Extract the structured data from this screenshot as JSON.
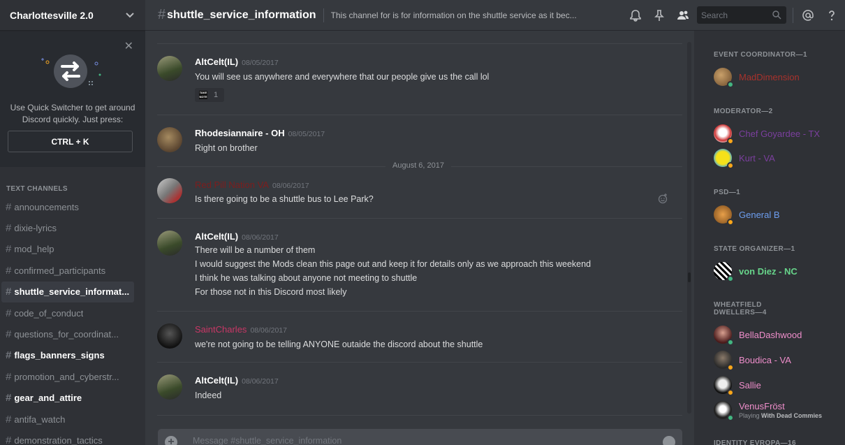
{
  "guild": {
    "name": "Charlottesville 2.0"
  },
  "quick_switcher": {
    "text_line1": "Use Quick Switcher to get around",
    "text_line2": "Discord quickly. Just press:",
    "shortcut": "CTRL + K"
  },
  "sidebar": {
    "category": "TEXT CHANNELS",
    "channels": [
      {
        "name": "announcements",
        "state": "normal"
      },
      {
        "name": "dixie-lyrics",
        "state": "normal"
      },
      {
        "name": "mod_help",
        "state": "normal"
      },
      {
        "name": "confirmed_participants",
        "state": "normal"
      },
      {
        "name": "shuttle_service_informat...",
        "state": "active"
      },
      {
        "name": "code_of_conduct",
        "state": "normal"
      },
      {
        "name": "questions_for_coordinat...",
        "state": "normal"
      },
      {
        "name": "flags_banners_signs",
        "state": "unread"
      },
      {
        "name": "promotion_and_cyberstr...",
        "state": "normal"
      },
      {
        "name": "gear_and_attire",
        "state": "unread"
      },
      {
        "name": "antifa_watch",
        "state": "normal"
      },
      {
        "name": "demonstration_tactics",
        "state": "normal"
      }
    ]
  },
  "header": {
    "channel": "shuttle_service_information",
    "topic": "This channel for is for information on the shuttle service as it bec...",
    "search_placeholder": "Search"
  },
  "messages": {
    "date_separator": "August 6, 2017",
    "groups": [
      {
        "author": "AltCelt(IL)",
        "time": "08/05/2017",
        "lines": [
          "You will see us anywhere and everywhere that our people give us the call lol"
        ],
        "reaction": {
          "emoji_text": "TAKE NOTE",
          "count": "1"
        }
      },
      {
        "author": "Rhodesiannaire - OH",
        "time": "08/05/2017",
        "lines": [
          "Right on brother"
        ]
      },
      {
        "author": "Red Pill Nation VA",
        "time": "08/06/2017",
        "lines": [
          "Is there going to be a shuttle bus to Lee Park?"
        ]
      },
      {
        "author": "AltCelt(IL)",
        "time": "08/06/2017",
        "lines": [
          "There will be a number of them",
          "I would suggest the Mods clean this page out and keep it for details only as we approach this weekend",
          "I think he was talking about anyone not meeting to shuttle",
          "For those not in this Discord most likely"
        ]
      },
      {
        "author": "SaintCharles",
        "time": "08/06/2017",
        "lines": [
          "we're not going to be telling ANYONE outaide the discord about the shuttle"
        ]
      },
      {
        "author": "AltCelt(IL)",
        "time": "08/06/2017",
        "lines": [
          "Indeed"
        ]
      }
    ],
    "composer_placeholder": "Message #shuttle_service_information"
  },
  "members": {
    "roles": [
      {
        "title": "EVENT COORDINATOR—1",
        "members": [
          {
            "name": "MadDimension",
            "color": "#a8322c",
            "status": "online"
          }
        ]
      },
      {
        "title": "MODERATOR—2",
        "members": [
          {
            "name": "Chef Goyardee - TX",
            "color": "#7b3f9e",
            "status": "idle"
          },
          {
            "name": "Kurt - VA",
            "color": "#7b3f9e",
            "status": "idle"
          }
        ]
      },
      {
        "title": "PSD—1",
        "members": [
          {
            "name": "General B",
            "color": "#6d9ef0",
            "status": "idle"
          }
        ]
      },
      {
        "title": "STATE ORGANIZER—1",
        "members": [
          {
            "name": "von Diez - NC",
            "color": "#67d48a",
            "status": "online"
          }
        ]
      },
      {
        "title_line1": "WHEATFIELD",
        "title_line2": "DWELLERS—4",
        "members": [
          {
            "name": "BellaDashwood",
            "color": "#ef8ecb",
            "status": "online"
          },
          {
            "name": "Boudica - VA",
            "color": "#ef8ecb",
            "status": "idle"
          },
          {
            "name": "Sallie",
            "color": "#ef8ecb",
            "status": "idle"
          },
          {
            "name": "VenusFröst",
            "color": "#ef8ecb",
            "status": "online",
            "activity_prefix": "Playing",
            "activity": "With Dead Commies"
          }
        ]
      },
      {
        "title": "IDENTITY EVROPA—16"
      }
    ]
  }
}
